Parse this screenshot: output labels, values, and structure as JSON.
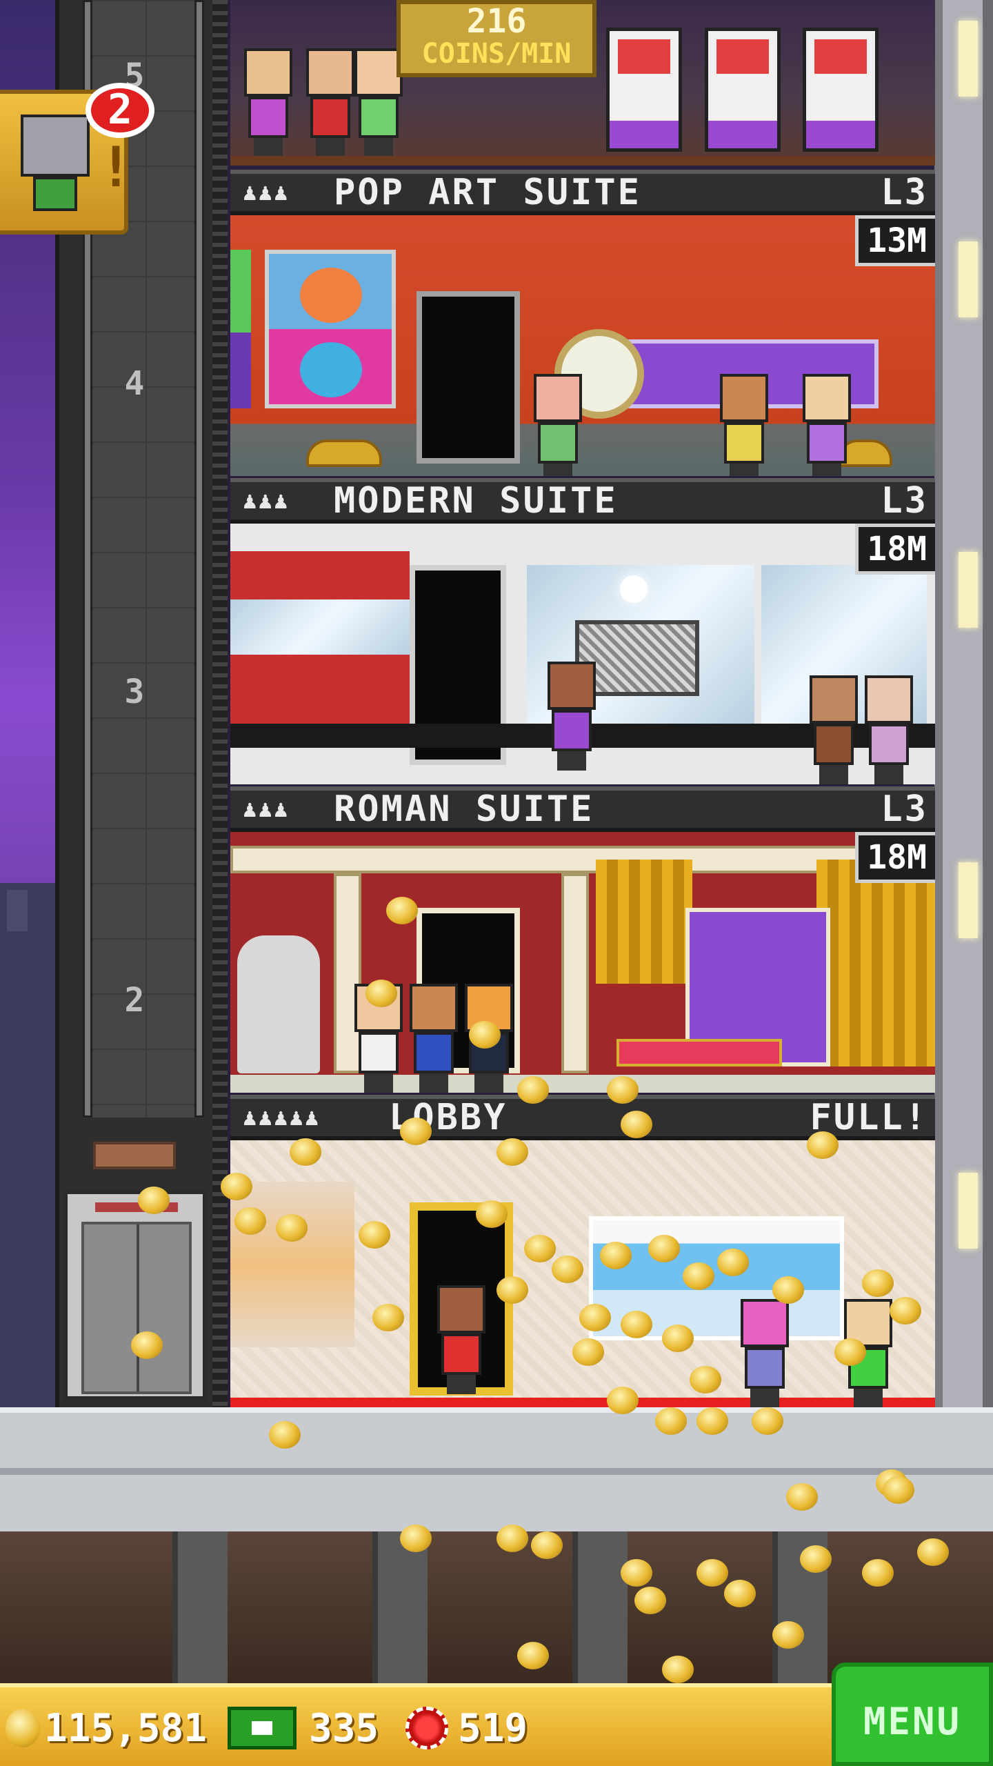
{
  "header": {
    "coins_per_min_value": "216",
    "coins_per_min_unit": "COINS/MIN"
  },
  "notification": {
    "badge_count": "2",
    "icon": "zombie-visitor-icon"
  },
  "floors": [
    {
      "people": "♟♟♟",
      "name": "POP ART SUITE",
      "level": "L3",
      "timer": "13M"
    },
    {
      "people": "♟♟♟",
      "name": "MODERN SUITE",
      "level": "L3",
      "timer": "18M"
    },
    {
      "people": "♟♟♟",
      "name": "ROMAN SUITE",
      "level": "L3",
      "timer": "18M"
    },
    {
      "people": "♟♟♟♟♟",
      "name": "LOBBY",
      "level": "FULL!",
      "timer": ""
    }
  ],
  "elevator": {
    "floor_numbers": [
      "5",
      "4",
      "3",
      "2"
    ]
  },
  "bottom_bar": {
    "coins": "115,581",
    "bux": "335",
    "gems": "519",
    "menu_label": "MENU"
  },
  "colors": {
    "accent_gold": "#e0a020",
    "menu_green": "#30c030",
    "room_red": "#c8421f"
  }
}
